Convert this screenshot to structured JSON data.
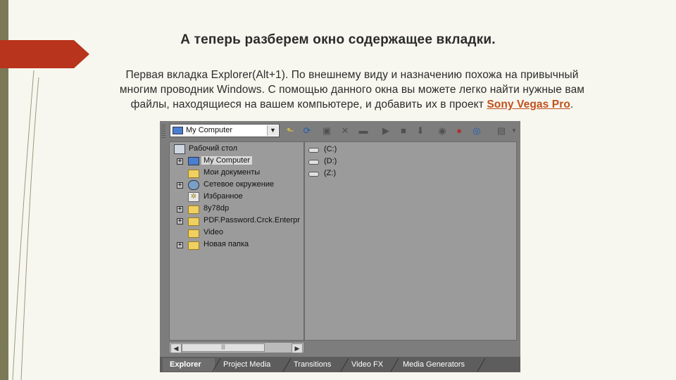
{
  "slide": {
    "title": "А теперь разберем окно содержащее вкладки.",
    "desc_line1": "Первая вкладка Explorer(Alt+1). По внешнему виду и назначению похожа на привычный",
    "desc_line2": "многим проводник Windows. С помощью данного окна вы можете легко найти нужные вам",
    "desc_line3a": "файлы, находящиеся на вашем компьютере, и добавить их в проект ",
    "desc_brand": "Sony Vegas Pro",
    "desc_end": ".",
    "brand_color": "#c0501c",
    "accent_color": "#b8341c"
  },
  "explorer": {
    "location": "My Computer",
    "toolbar_icons": [
      "up-folder-icon",
      "refresh-icon",
      "new-folder-icon",
      "delete-icon",
      "folder-icon",
      "play-icon",
      "stop-icon",
      "insert-icon",
      "properties-icon",
      "favorites-icon",
      "cd-icon",
      "views-icon"
    ],
    "tree": [
      {
        "label": "Рабочий стол",
        "icon": "desktop-icon",
        "expander": ""
      },
      {
        "label": "My Computer",
        "icon": "computer-icon",
        "expander": "+",
        "selected": true
      },
      {
        "label": "Мои документы",
        "icon": "folder-icon",
        "expander": ""
      },
      {
        "label": "Сетевое окружение",
        "icon": "network-icon",
        "expander": "+"
      },
      {
        "label": "Избранное",
        "icon": "favorites-icon",
        "expander": ""
      },
      {
        "label": "8y78dp",
        "icon": "folder-icon",
        "expander": "+"
      },
      {
        "label": "PDF.Password.Crck.Enterpr",
        "icon": "folder-icon",
        "expander": "+"
      },
      {
        "label": "Video",
        "icon": "folder-icon",
        "expander": ""
      },
      {
        "label": "Новая папка",
        "icon": "folder-icon",
        "expander": "+"
      }
    ],
    "drives": [
      "(C:)",
      "(D:)",
      "(Z:)"
    ],
    "tabs": [
      "Explorer",
      "Project Media",
      "Transitions",
      "Video FX",
      "Media Generators"
    ]
  }
}
